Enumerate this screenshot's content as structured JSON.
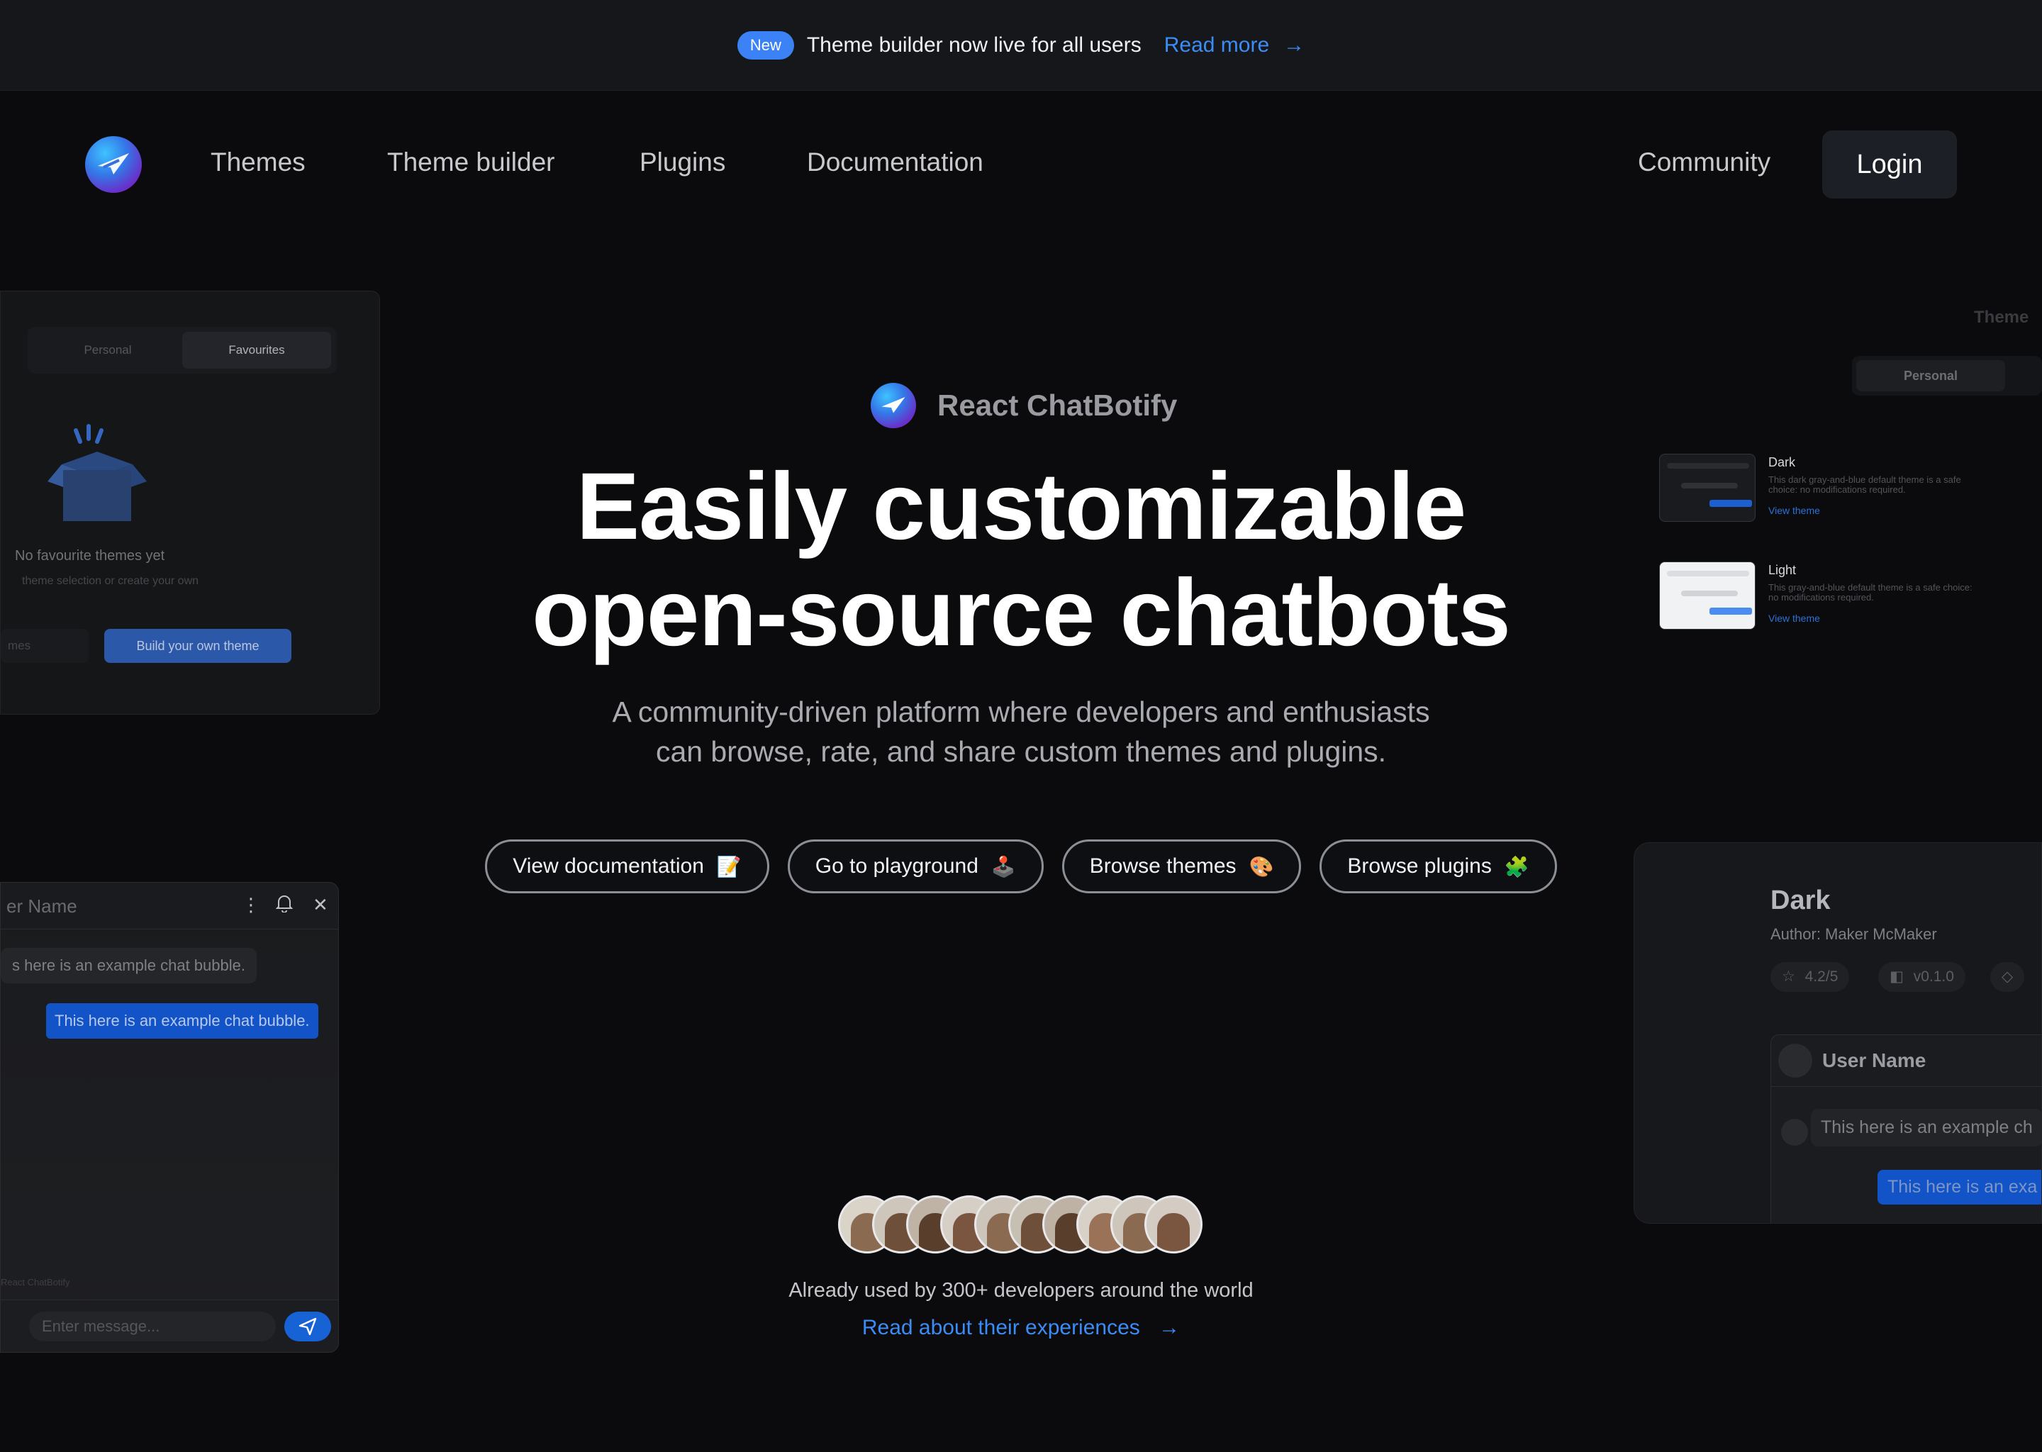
{
  "announcement": {
    "badge": "New",
    "text": "Theme builder now live for all users",
    "link_label": "Read more",
    "arrow": "→"
  },
  "nav": {
    "links": [
      "Themes",
      "Theme builder",
      "Plugins",
      "Documentation"
    ],
    "community": "Community",
    "login": "Login"
  },
  "hero": {
    "brand": "React ChatBotify",
    "title_line1": "Easily customizable",
    "title_line2": "open-source chatbots",
    "subtitle_line1": "A community-driven platform where developers and enthusiasts",
    "subtitle_line2": "can browse, rate, and share custom themes and plugins.",
    "ctas": [
      {
        "label": "View documentation",
        "emoji": "📝"
      },
      {
        "label": "Go to playground",
        "emoji": "🕹️"
      },
      {
        "label": "Browse themes",
        "emoji": "🎨"
      },
      {
        "label": "Browse plugins",
        "emoji": "🧩"
      }
    ],
    "used_text": "Already used by 300+ developers around the world",
    "read_experiences": "Read about their experiences",
    "arrow": "→"
  },
  "left_panel": {
    "tab_personal": "Personal",
    "tab_favourites": "Favourites",
    "empty_title": "No favourite themes yet",
    "empty_sub": "theme selection or create your own",
    "ghost_button": "mes",
    "build_button": "Build your own theme"
  },
  "left_chat": {
    "header_name": "er Name",
    "bubble_bot": "s here is an example chat bubble.",
    "bubble_user": "This here is an example chat bubble.",
    "powered": "React ChatBotify",
    "input_placeholder": "Enter message..."
  },
  "right_top": {
    "title": "Theme",
    "tab_personal": "Personal",
    "themes": [
      {
        "name": "Dark",
        "desc": "This dark gray-and-blue default theme is a safe choice: no modifications required.",
        "link": "View theme"
      },
      {
        "name": "Light",
        "desc": "This gray-and-blue default theme is a safe choice: no modifications required.",
        "link": "View theme"
      }
    ]
  },
  "right_bottom": {
    "title": "Dark",
    "author": "Author: Maker McMaker",
    "rating": "4.2/5",
    "version": "v0.1.0",
    "chat_user_name": "User Name",
    "bubble_bot": "This here is an example ch",
    "bubble_user": "This here is an exa"
  },
  "colors": {
    "background": "#0b0b0d",
    "accent": "#3b8cf5",
    "badge": "#3b82f6"
  }
}
